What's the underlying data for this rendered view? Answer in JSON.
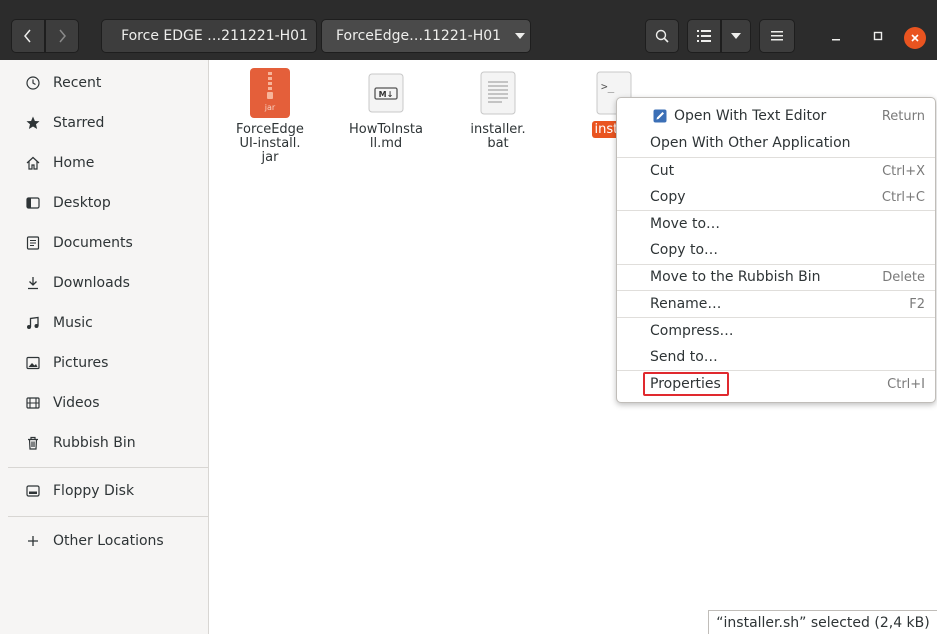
{
  "header": {
    "breadcrumb_1": "Force EDGE …211221-H01",
    "breadcrumb_2": "ForceEdge…11221-H01"
  },
  "sidebar": {
    "items": [
      {
        "label": "Recent",
        "icon": "clock-icon"
      },
      {
        "label": "Starred",
        "icon": "star-icon"
      },
      {
        "label": "Home",
        "icon": "home-icon"
      },
      {
        "label": "Desktop",
        "icon": "desktop-icon"
      },
      {
        "label": "Documents",
        "icon": "documents-icon"
      },
      {
        "label": "Downloads",
        "icon": "download-icon"
      },
      {
        "label": "Music",
        "icon": "music-icon"
      },
      {
        "label": "Pictures",
        "icon": "pictures-icon"
      },
      {
        "label": "Videos",
        "icon": "videos-icon"
      },
      {
        "label": "Rubbish Bin",
        "icon": "trash-icon"
      },
      {
        "label": "Floppy Disk",
        "icon": "drive-icon"
      },
      {
        "label": "Other Locations",
        "icon": "plus-icon"
      }
    ]
  },
  "files": [
    {
      "name_lines": [
        "ForceEdge",
        "UI-install.",
        "jar"
      ],
      "type_label": "jar",
      "icon": "jar-archive-icon"
    },
    {
      "name_lines": [
        "HowToInsta",
        "ll.md"
      ],
      "type_label": "M↓",
      "icon": "markdown-file-icon"
    },
    {
      "name_lines": [
        "installer.",
        "bat"
      ],
      "icon": "text-file-icon"
    },
    {
      "name_lines": [
        "install"
      ],
      "type_label": ">_",
      "icon": "script-file-icon",
      "selected": true
    }
  ],
  "context_menu": {
    "items": [
      {
        "label": "Open With Text Editor",
        "accel": "Return",
        "icon": "text-editor-icon"
      },
      {
        "label": "Open With Other Application",
        "accel": ""
      },
      {
        "label": "Cut",
        "accel": "Ctrl+X"
      },
      {
        "label": "Copy",
        "accel": "Ctrl+C"
      },
      {
        "label": "Move to…",
        "accel": ""
      },
      {
        "label": "Copy to…",
        "accel": ""
      },
      {
        "label": "Move to the Rubbish Bin",
        "accel": "Delete"
      },
      {
        "label": "Rename…",
        "accel": "F2"
      },
      {
        "label": "Compress…",
        "accel": ""
      },
      {
        "label": "Send to…",
        "accel": ""
      },
      {
        "label": "Properties",
        "accel": "Ctrl+I"
      }
    ]
  },
  "status": {
    "text": "“installer.sh” selected  (2,4 kB)"
  },
  "colors": {
    "accent": "#e95420",
    "highlight_box": "#e0292e"
  }
}
